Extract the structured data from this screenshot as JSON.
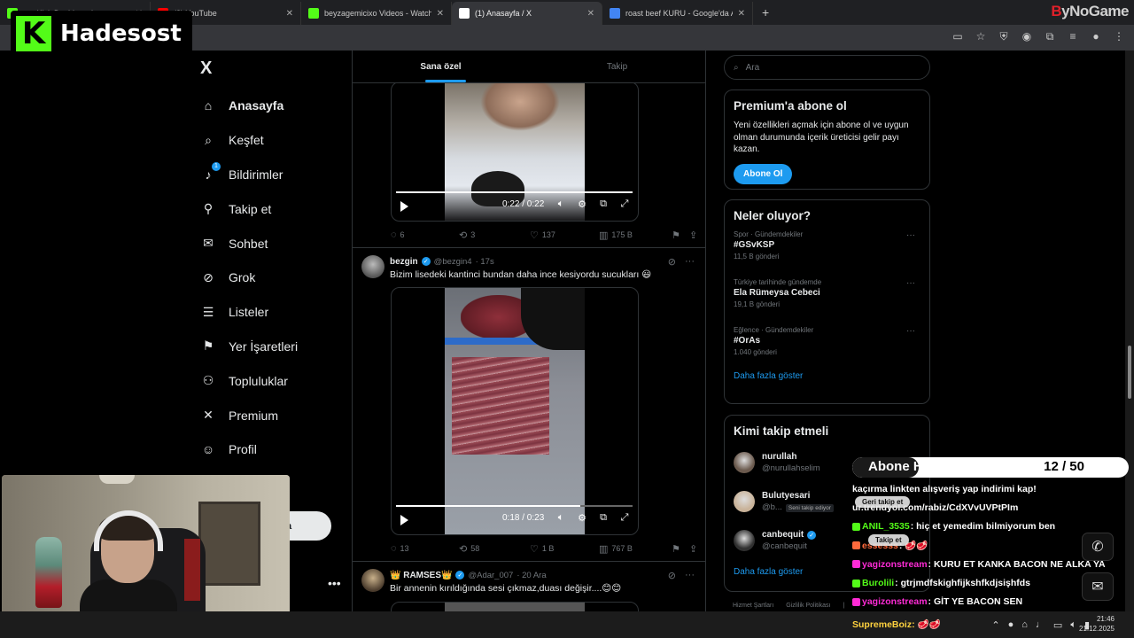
{
  "browser": {
    "tabs": [
      {
        "title": "m - Kick Dashboard",
        "favicon_color": "#53fc18",
        "active": false
      },
      {
        "title": "(8) YouTube",
        "favicon_color": "#ff0000",
        "active": false
      },
      {
        "title": "beyzagemicixo Videos - Watch",
        "favicon_color": "#53fc18",
        "active": false
      },
      {
        "title": "(1) Anasayfa / X",
        "favicon_color": "#ffffff",
        "active": true
      },
      {
        "title": "roast beef KURU - Google'da A",
        "favicon_color": "#4285f4",
        "active": false
      }
    ],
    "new_tab": "+",
    "brand_b": "B",
    "brand_rest": "yNoGame"
  },
  "overlay_logo": {
    "letter": "K",
    "name": "Hadesost"
  },
  "x": {
    "logo": "X",
    "nav": [
      {
        "label": "Anasayfa",
        "icon": "home-icon",
        "glyph": "⌂",
        "active": true
      },
      {
        "label": "Keşfet",
        "icon": "search-icon",
        "glyph": "⌕"
      },
      {
        "label": "Bildirimler",
        "icon": "bell-icon",
        "glyph": "♪",
        "badge": "1"
      },
      {
        "label": "Takip et",
        "icon": "person-add-icon",
        "glyph": "⚲"
      },
      {
        "label": "Sohbet",
        "icon": "mail-icon",
        "glyph": "✉"
      },
      {
        "label": "Grok",
        "icon": "grok-icon",
        "glyph": "⊘"
      },
      {
        "label": "Listeler",
        "icon": "list-icon",
        "glyph": "☰"
      },
      {
        "label": "Yer İşaretleri",
        "icon": "bookmark-icon",
        "glyph": "⚑"
      },
      {
        "label": "Topluluklar",
        "icon": "communities-icon",
        "glyph": "⚇"
      },
      {
        "label": "Premium",
        "icon": "premium-x-icon",
        "glyph": "✕"
      },
      {
        "label": "Profil",
        "icon": "profile-icon",
        "glyph": "☺"
      }
    ],
    "post_button": "la",
    "more": "•••",
    "timeline_tabs": [
      "Sana özel",
      "Takip"
    ],
    "tweet1": {
      "video_time": "0:22 / 0:22",
      "progress": 1.0,
      "replies": "6",
      "retweets": "3",
      "likes": "137",
      "views": "175 B"
    },
    "tweet2": {
      "name": "bezgin",
      "handle": "@bezgin4",
      "time": "· 17s",
      "text": "Bizim lisedeki kantinci bundan daha ince kesiyordu sucukları 😃",
      "video_time": "0:18 / 0:23",
      "progress": 0.78,
      "replies": "13",
      "retweets": "58",
      "likes": "1 B",
      "views": "767 B"
    },
    "tweet3": {
      "name": "👑 RAMSES👑",
      "handle": "@Adar_007",
      "time": "· 20 Ara",
      "text": "Bir annenin kırıldığında sesi çıkmaz,duası değişir....😊😊"
    },
    "search_placeholder": "Ara",
    "premium": {
      "title": "Premium'a abone ol",
      "text": "Yeni özellikleri açmak için abone ol ve uygun olman durumunda içerik üreticisi gelir payı kazan.",
      "button": "Abone Ol"
    },
    "trends": {
      "title": "Neler oluyor?",
      "items": [
        {
          "category": "Spor · Gündemdekiler",
          "tag": "#GSvKSP",
          "count": "11,5 B gönderi"
        },
        {
          "category": "Türkiye tarihinde gündemde",
          "tag": "Ela Rümeysa Cebeci",
          "count": "19,1 B gönderi"
        },
        {
          "category": "Eğlence · Gündemdekiler",
          "tag": "#OrAs",
          "count": "1.040 gönderi"
        }
      ],
      "show_more": "Daha fazla göster"
    },
    "who_to_follow": {
      "title": "Kimi takip etmeli",
      "items": [
        {
          "name": "nurullah",
          "handle": "@nurullahselim",
          "verified": false
        },
        {
          "name": "Bulutyesari",
          "handle": "@b...",
          "verified": false,
          "tag": "Seni takip ediyor"
        },
        {
          "name": "canbequit",
          "handle": "@canbequit",
          "verified": true
        }
      ],
      "show_more": "Daha fazla göster"
    },
    "footer": [
      "Hizmet Şartları",
      "Gizlilik Politikası",
      "|"
    ]
  },
  "stream": {
    "goal_label": "Abone Hedefi:",
    "goal_value": "12 / 50",
    "goal_progress": 0.24,
    "chat": [
      {
        "user": "",
        "text": "kaçırma linkten alışveriş yap indirimi kap!",
        "color": "#ffffff"
      },
      {
        "user": "",
        "text": "ur.trendyol.com/rabiz/CdXVvUVPtPIm",
        "color": "#ffffff"
      },
      {
        "user": "ANIL_3535",
        "text": ": hiç et yemedim bilmiyorum ben",
        "color": "#53fc18"
      },
      {
        "user": "essesss",
        "text": ": 🥩🥩",
        "color": "#ff6a3d"
      },
      {
        "user": "yagizonstream",
        "text": ": KURU ET KANKA BACON NE ALKA YA",
        "color": "#ff2bd6"
      },
      {
        "user": "Burolili",
        "text": ": gtrjmdfskighfijkshfkdjsişhfds",
        "color": "#53fc18"
      },
      {
        "user": "yagizonstream",
        "text": ": GİT YE BACON SEN",
        "color": "#ff2bd6"
      }
    ],
    "chat_pill_1": "Geri takip et",
    "chat_pill_2": "Takip et",
    "supreme_user": "SupremeBoiz:",
    "supreme_text": "🥩🥩"
  },
  "taskbar": {
    "time": "21:46",
    "date": "21.12.2025"
  }
}
